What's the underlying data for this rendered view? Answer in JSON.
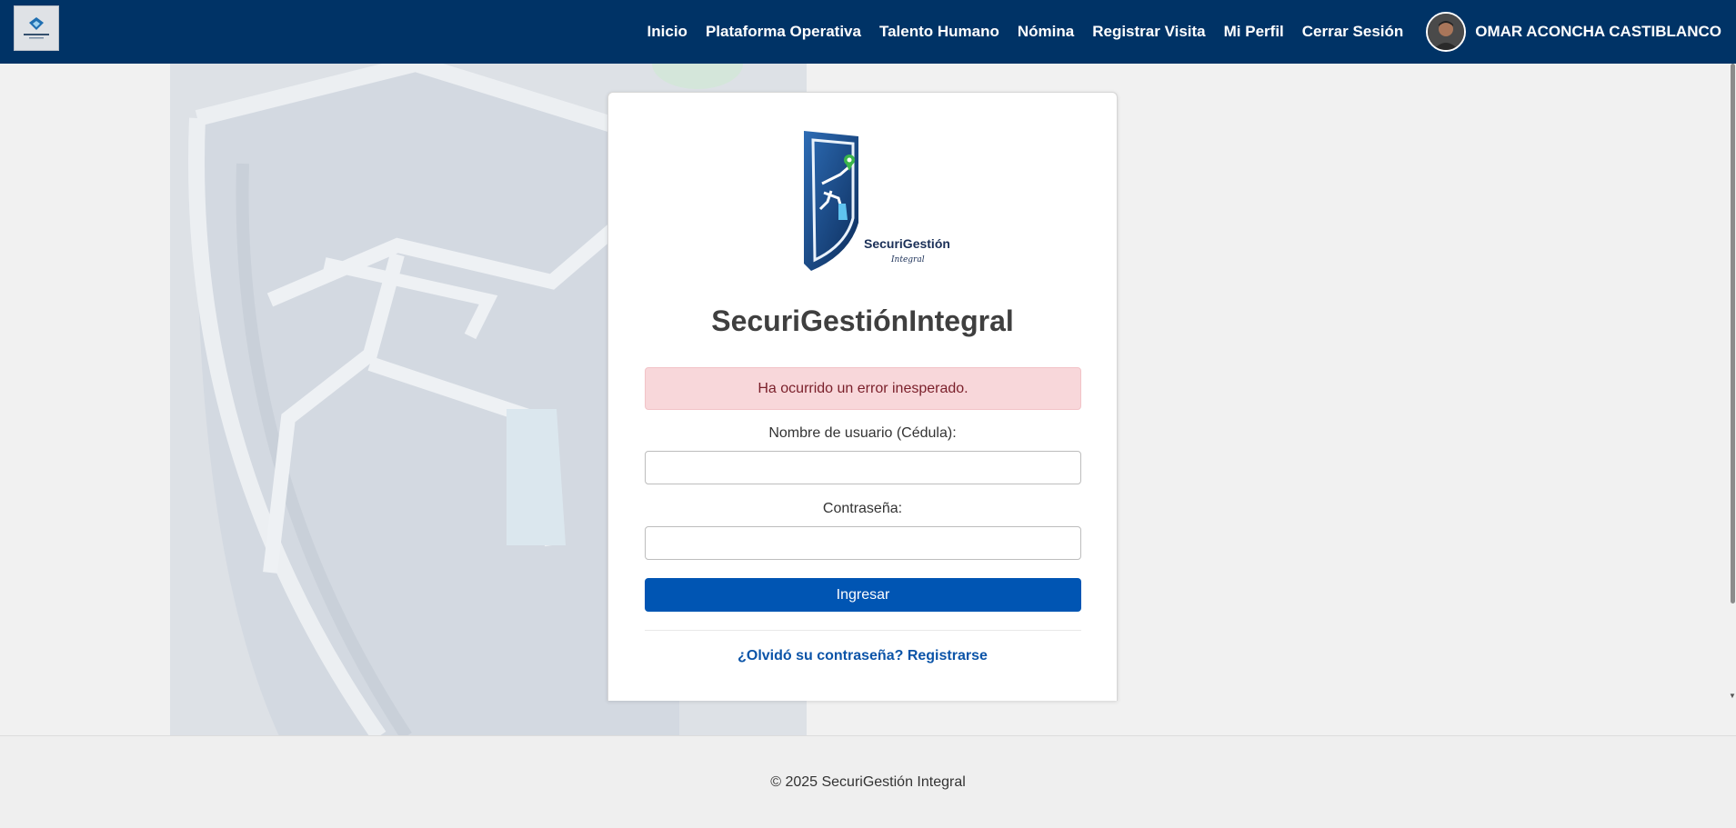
{
  "nav": {
    "items": [
      {
        "label": "Inicio"
      },
      {
        "label": "Plataforma Operativa"
      },
      {
        "label": "Talento Humano"
      },
      {
        "label": "Nómina"
      },
      {
        "label": "Registrar Visita"
      },
      {
        "label": "Mi Perfil"
      },
      {
        "label": "Cerrar Sesión"
      }
    ],
    "user_name": "OMAR ACONCHA CASTIBLANCO"
  },
  "login": {
    "logo_text_main": "SecuriGestión",
    "logo_text_sub": "Integral",
    "title": "SecuriGestiónIntegral",
    "error_message": "Ha ocurrido un error inesperado.",
    "username_label": "Nombre de usuario (Cédula):",
    "username_value": "",
    "password_label": "Contraseña:",
    "password_value": "",
    "submit_label": "Ingresar",
    "forgot_link": "¿Olvidó su contraseña?",
    "register_link": "Registrarse"
  },
  "footer": {
    "text": "© 2025 SecuriGestión Integral"
  },
  "colors": {
    "header_bg": "#003366",
    "button_bg": "#0055b3",
    "alert_bg": "#f8d7da",
    "link": "#0b54a8"
  },
  "icons": [
    "brand-logo-icon",
    "user-avatar",
    "shield-logo-icon",
    "background-shield-watermark"
  ]
}
